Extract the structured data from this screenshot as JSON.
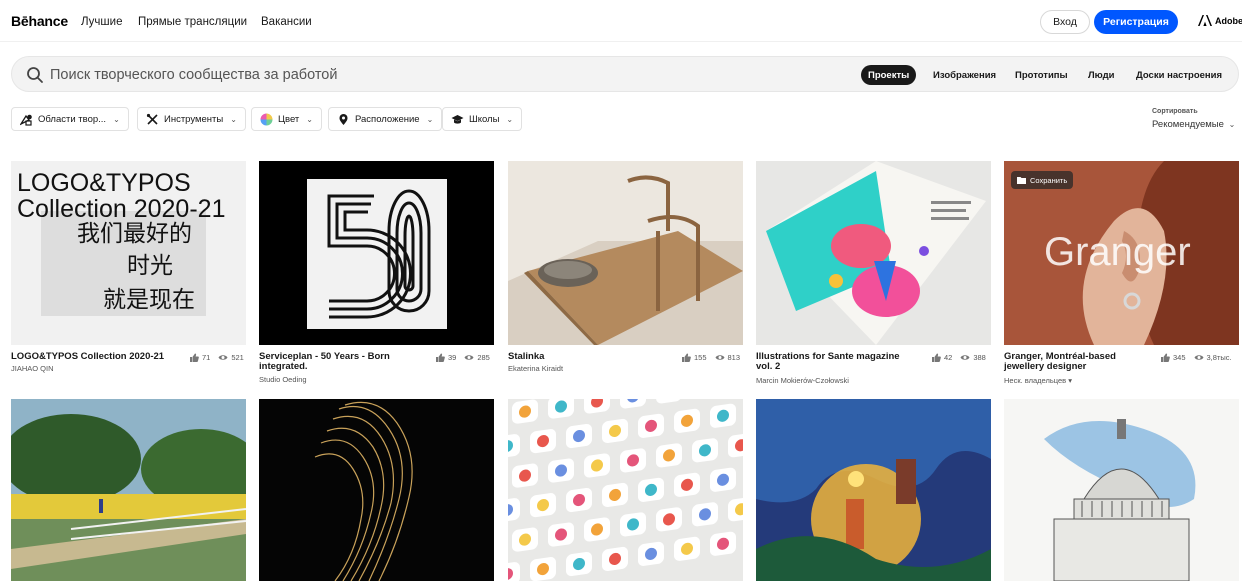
{
  "header": {
    "logo": "Bēhance",
    "nav": [
      "Лучшие",
      "Прямые трансляции",
      "Вакансии"
    ],
    "login": "Вход",
    "register": "Регистрация",
    "adobe": "Adobe",
    "register_color": "#0057ff"
  },
  "search": {
    "placeholder": "Поиск творческого сообщества за работой",
    "tabs": [
      "Проекты",
      "Изображения",
      "Прототипы",
      "Люди",
      "Доски настроения"
    ],
    "active_tab": "Проекты"
  },
  "filters": [
    {
      "label": "Области твор...",
      "icon": "creative-fields-icon"
    },
    {
      "label": "Инструменты",
      "icon": "tools-icon"
    },
    {
      "label": "Цвет",
      "icon": "color-wheel-icon"
    },
    {
      "label": "Расположение",
      "icon": "location-pin-icon"
    },
    {
      "label": "Школы",
      "icon": "graduation-cap-icon"
    }
  ],
  "sort": {
    "label": "Сортировать",
    "value": "Рекомендуемые"
  },
  "projects": [
    {
      "title": "LOGO&TYPOS Collection 2020-21",
      "owner": "JIAHAO QIN",
      "likes": "71",
      "views": "521",
      "art_text": [
        "LOGO&TYPOS",
        "Collection 2020-21",
        "我们最好的",
        "时光",
        "就是现在"
      ]
    },
    {
      "title": "Serviceplan - 50 Years - Born integrated.",
      "owner": "Studio Oeding",
      "likes": "39",
      "views": "285"
    },
    {
      "title": "Stalinka",
      "owner": "Ekaterina Kiraidt",
      "likes": "155",
      "views": "813"
    },
    {
      "title": "Illustrations for Sante magazine vol. 2",
      "owner": "Marcin Mokierów-Czołowski",
      "likes": "42",
      "views": "388"
    },
    {
      "title": "Granger, Montréal-based jewellery designer",
      "owner": "Неск. владельцев",
      "likes": "345",
      "views": "3,8тыс.",
      "art_text": "Granger",
      "save_label": "Сохранить"
    }
  ]
}
